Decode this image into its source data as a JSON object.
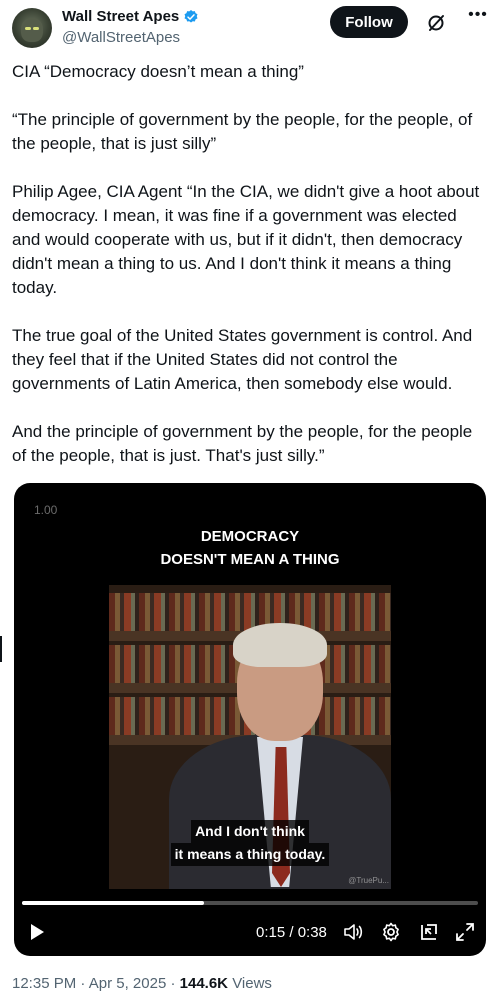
{
  "author": {
    "name": "Wall Street Apes",
    "handle": "@WallStreetApes",
    "verified": true
  },
  "actions": {
    "follow_label": "Follow",
    "grok_icon": "grok-slash-icon",
    "more_icon": "more-dots-icon"
  },
  "tweet": {
    "paragraphs": [
      "CIA “Democracy doesn’t mean a thing”",
      "“The principle of government by the people, for the people, of the people, that is just silly”",
      "Philip Agee, CIA Agent “In the CIA, we didn't give a hoot about democracy. I mean, it was fine if a government was elected and would cooperate with us, but if it didn't, then democracy didn't mean a thing to us. And I don't think it means a thing today.",
      "The true goal of the United States government is control. And they feel that if the United States did not control the governments of Latin America, then somebody else would.",
      "And the principle of government by the people, for the people of the people, that is just. That's just silly.”"
    ]
  },
  "video": {
    "rate": "1.00",
    "title_line1": "DEMOCRACY",
    "title_line2": "DOESN'T MEAN A THING",
    "caption_line1": "And I don't think",
    "caption_line2": "it means a thing today.",
    "watermark": "@TruePu...",
    "current_time": "0:15",
    "duration": "0:38",
    "time_display": "0:15 / 0:38",
    "progress_fraction": 0.4
  },
  "meta": {
    "time": "12:35 PM",
    "date": "Apr 5, 2025",
    "views_count": "144.6K",
    "views_label": "Views"
  },
  "colors": {
    "text": "#0f1419",
    "secondary": "#536471",
    "verified": "#1d9bf0",
    "button_bg": "#0f1419"
  }
}
